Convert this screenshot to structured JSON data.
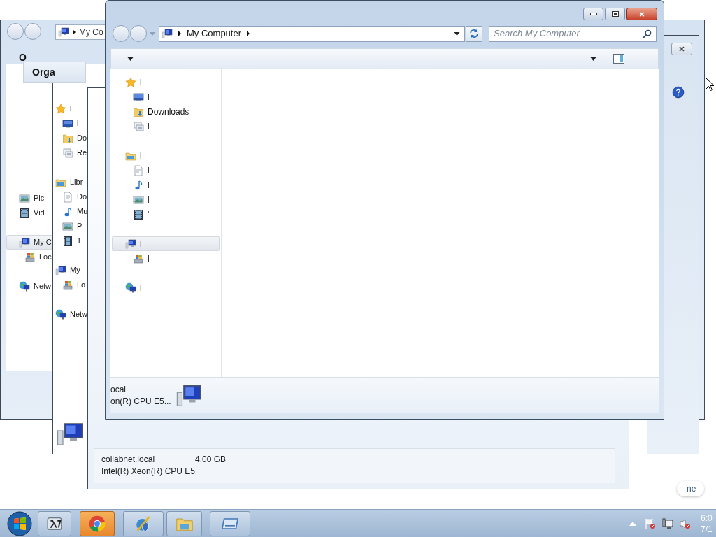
{
  "back_window": {
    "address": "My Co",
    "toolbar_label": "O",
    "nav_tree": [
      {
        "kind": "pictures",
        "label": "Pic",
        "selected": false
      },
      {
        "kind": "videos",
        "label": "Vid",
        "selected": false
      },
      {
        "kind": "computer",
        "label": "My C",
        "selected": true,
        "children": [
          {
            "kind": "drive",
            "label": "Loc",
            "selected": false
          }
        ]
      },
      {
        "kind": "network",
        "label": "Netw",
        "selected": false
      }
    ]
  },
  "organize_window": {
    "toolbar_label": "Orga"
  },
  "middle_window": {
    "nav_tree": [
      {
        "kind": "favorites",
        "label": "l",
        "selected": false,
        "children": [
          {
            "kind": "desktop",
            "label": "l",
            "selected": false
          },
          {
            "kind": "downloads",
            "label": "Do",
            "selected": false
          },
          {
            "kind": "recent",
            "label": "Re",
            "selected": false
          }
        ]
      },
      {
        "kind": "libraries",
        "label": "Libr",
        "selected": false,
        "children": [
          {
            "kind": "documents",
            "label": "Do",
            "selected": false
          },
          {
            "kind": "music",
            "label": "Mu",
            "selected": false
          },
          {
            "kind": "pictures",
            "label": "Pi",
            "selected": false
          },
          {
            "kind": "videos",
            "label": "1",
            "selected": false
          }
        ]
      },
      {
        "kind": "computer",
        "label": "My",
        "selected": false,
        "children": [
          {
            "kind": "drive",
            "label": "Lo",
            "selected": false
          }
        ]
      },
      {
        "kind": "network",
        "label": "Netw",
        "selected": false
      }
    ]
  },
  "details_window": {
    "details": {
      "name": "collabnet.local",
      "memory": "4.00 GB",
      "processor": "Intel(R) Xeon(R) CPU E5"
    }
  },
  "start_hint": "ne",
  "main_window": {
    "address": "My Computer",
    "search": {
      "placeholder": "Search My Computer"
    },
    "nav_tree": [
      {
        "kind": "favorites",
        "label": "l",
        "selected": false,
        "children": [
          {
            "kind": "desktop",
            "label": "l",
            "selected": false
          },
          {
            "kind": "downloads",
            "label": "Downloads",
            "selected": false
          },
          {
            "kind": "recent",
            "label": "l",
            "selected": false
          }
        ]
      },
      {
        "kind": "libraries",
        "label": "l",
        "selected": false,
        "children": [
          {
            "kind": "documents",
            "label": "l",
            "selected": false
          },
          {
            "kind": "music",
            "label": "l",
            "selected": false
          },
          {
            "kind": "pictures",
            "label": "l",
            "selected": false
          },
          {
            "kind": "videos",
            "label": "'",
            "selected": false
          }
        ]
      },
      {
        "kind": "computer",
        "label": "l",
        "selected": true,
        "children": [
          {
            "kind": "drive",
            "label": "l",
            "selected": false
          }
        ]
      },
      {
        "kind": "network",
        "label": "l",
        "selected": false
      }
    ],
    "details": {
      "name": "ocal",
      "processor": "on(R) CPU E5..."
    }
  },
  "taskbar": {
    "buttons": [
      {
        "kind": "terminal",
        "selected": false
      },
      {
        "kind": "chrome",
        "selected": true
      },
      {
        "kind": "tools",
        "selected": false
      },
      {
        "kind": "explorer",
        "selected": false
      },
      {
        "kind": "app",
        "selected": false
      }
    ],
    "clock": {
      "time": "6:0",
      "date": "7/1"
    }
  }
}
